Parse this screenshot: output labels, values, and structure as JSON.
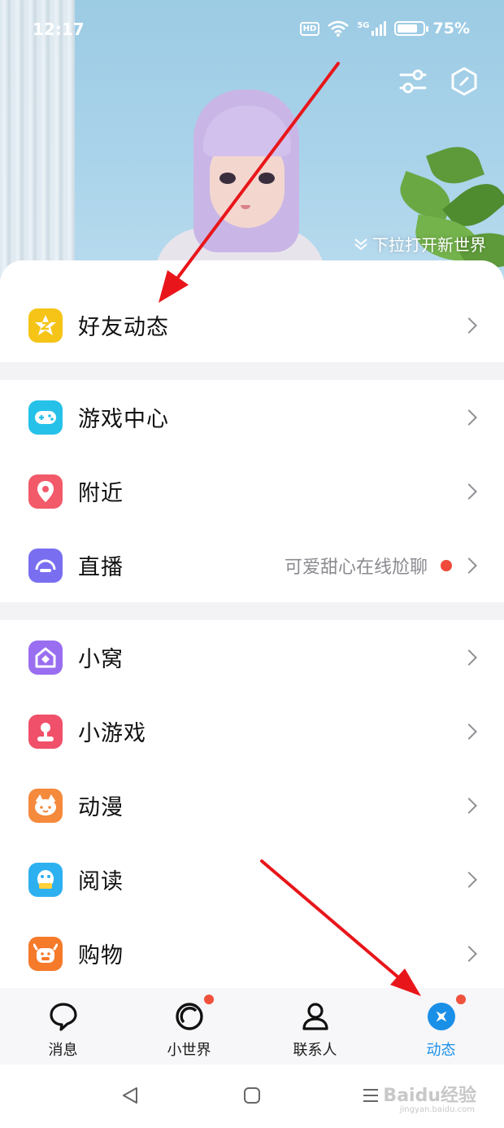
{
  "status_bar": {
    "time": "12:17",
    "hd_label": "HD",
    "network_label": "5G",
    "battery_text": "75%"
  },
  "header": {
    "pull_hint": "下拉打开新世界",
    "actions": [
      {
        "icon": "sliders-icon"
      },
      {
        "icon": "hexagon-settings-icon"
      }
    ]
  },
  "menu": {
    "group1": [
      {
        "label": "好友动态",
        "icon": "star-z-icon",
        "icon_color": "#f5c417"
      }
    ],
    "group2": [
      {
        "label": "游戏中心",
        "icon": "gamepad-icon",
        "icon_color": "#25c1e8"
      },
      {
        "label": "附近",
        "icon": "location-pin-icon",
        "icon_color": "#f25a6a"
      },
      {
        "label": "直播",
        "icon": "live-icon",
        "icon_color": "#7a6ef0",
        "subtitle": "可爱甜心在线尬聊",
        "dot_color": "#f04a3a"
      }
    ],
    "group3": [
      {
        "label": "小窝",
        "icon": "home-diamond-icon",
        "icon_color": "#9a6ef0"
      },
      {
        "label": "小游戏",
        "icon": "joystick-icon",
        "icon_color": "#f0506a"
      },
      {
        "label": "动漫",
        "icon": "anime-face-icon",
        "icon_color": "#f58a3c"
      },
      {
        "label": "阅读",
        "icon": "penguin-book-icon",
        "icon_color": "#2db0f0"
      },
      {
        "label": "购物",
        "icon": "shopping-cow-icon",
        "icon_color": "#f57a2a"
      }
    ]
  },
  "tabbar": {
    "tabs": [
      {
        "label": "消息",
        "icon": "chat-bubble-icon",
        "has_badge": false
      },
      {
        "label": "小世界",
        "icon": "small-world-icon",
        "has_badge": true
      },
      {
        "label": "联系人",
        "icon": "contacts-person-icon",
        "has_badge": false
      },
      {
        "label": "动态",
        "icon": "dynamic-star-icon",
        "has_badge": true,
        "active": true
      }
    ],
    "active_color": "#1a8fe8",
    "badge_color": "#f0513c"
  },
  "system_nav": {
    "watermark": "Baidu经验",
    "watermark_sub": "jingyan.baidu.com"
  },
  "annotation": {
    "arrow_color": "#e8161a"
  }
}
